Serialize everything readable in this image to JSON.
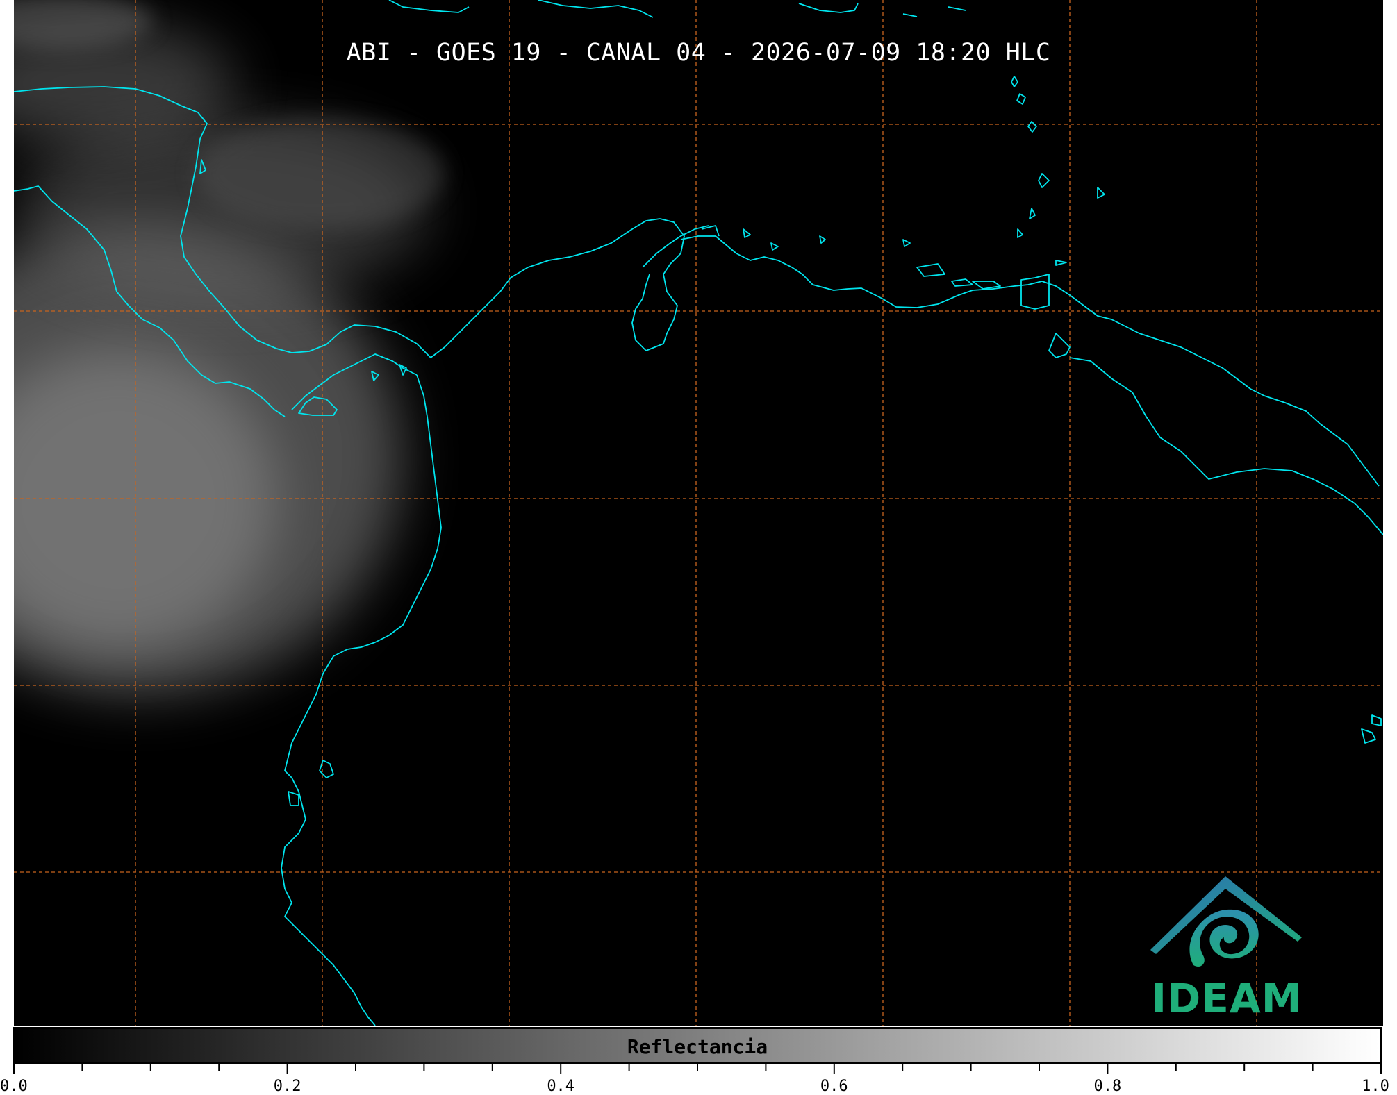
{
  "title": "ABI - GOES 19 - CANAL 04 - 2026-07-09 18:20 HLC",
  "colors": {
    "background": "#000000",
    "coastline": "#00e5ee",
    "graticule": "#c8641e",
    "cloud": "#9a9a9a",
    "logo_teal": "#1fae7a",
    "logo_blue": "#2d6fb6"
  },
  "logo": {
    "text": "IDEAM",
    "icon": "ideam-mountain-spiral-logo"
  },
  "colorbar": {
    "label": "Reflectancia",
    "range": [
      0.0,
      1.0
    ],
    "tick_labels": [
      "0.0",
      "0.2",
      "0.4",
      "0.6",
      "0.8",
      "1.0"
    ],
    "tick_values": [
      0.0,
      0.2,
      0.4,
      0.6,
      0.8,
      1.0
    ],
    "minor_tick_step": 0.05,
    "colormap": "grayscale black-to-white"
  }
}
